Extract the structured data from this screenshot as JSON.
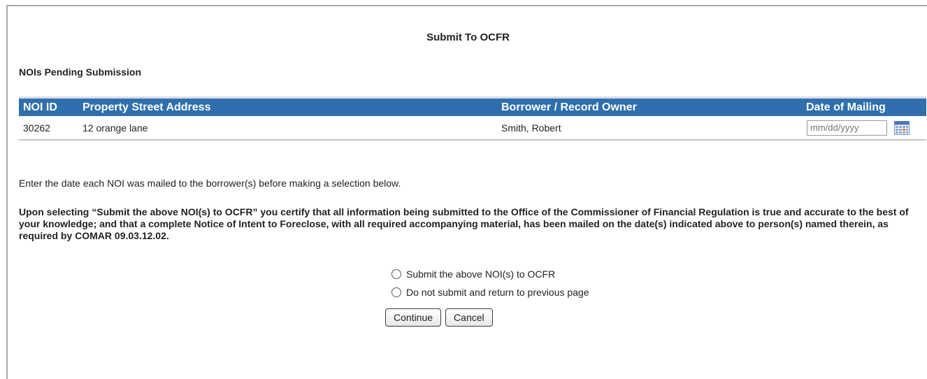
{
  "page": {
    "title": "Submit To OCFR",
    "section_heading": "NOIs Pending Submission"
  },
  "table": {
    "columns": [
      "NOI ID",
      "Property Street Address",
      "Borrower / Record Owner",
      "Date of Mailing"
    ],
    "rows": [
      {
        "noi_id": "30262",
        "address": "12 orange lane",
        "owner": "Smith, Robert",
        "date_value": "",
        "date_placeholder": "mm/dd/yyyy"
      }
    ]
  },
  "instruction": "Enter the date each NOI was mailed to the borrower(s) before making a selection below.",
  "certification": "Upon selecting “Submit the above NOI(s) to OCFR” you certify that all information being submitted to the Office of the Commissioner of Financial Regulation is true and accurate to the best of your knowledge; and that a complete Notice of Intent to Foreclose, with all required accompanying material, has been mailed on the date(s) indicated above to person(s) named therein, as required by COMAR 09.03.12.02.",
  "options": [
    {
      "label": "Submit the above NOI(s) to OCFR",
      "selected": false
    },
    {
      "label": "Do not submit and return to previous page",
      "selected": false
    }
  ],
  "buttons": {
    "continue": "Continue",
    "cancel": "Cancel"
  },
  "icons": {
    "calendar": "calendar-icon"
  },
  "colors": {
    "header_bg": "#2f6fad",
    "header_text": "#ffffff"
  }
}
